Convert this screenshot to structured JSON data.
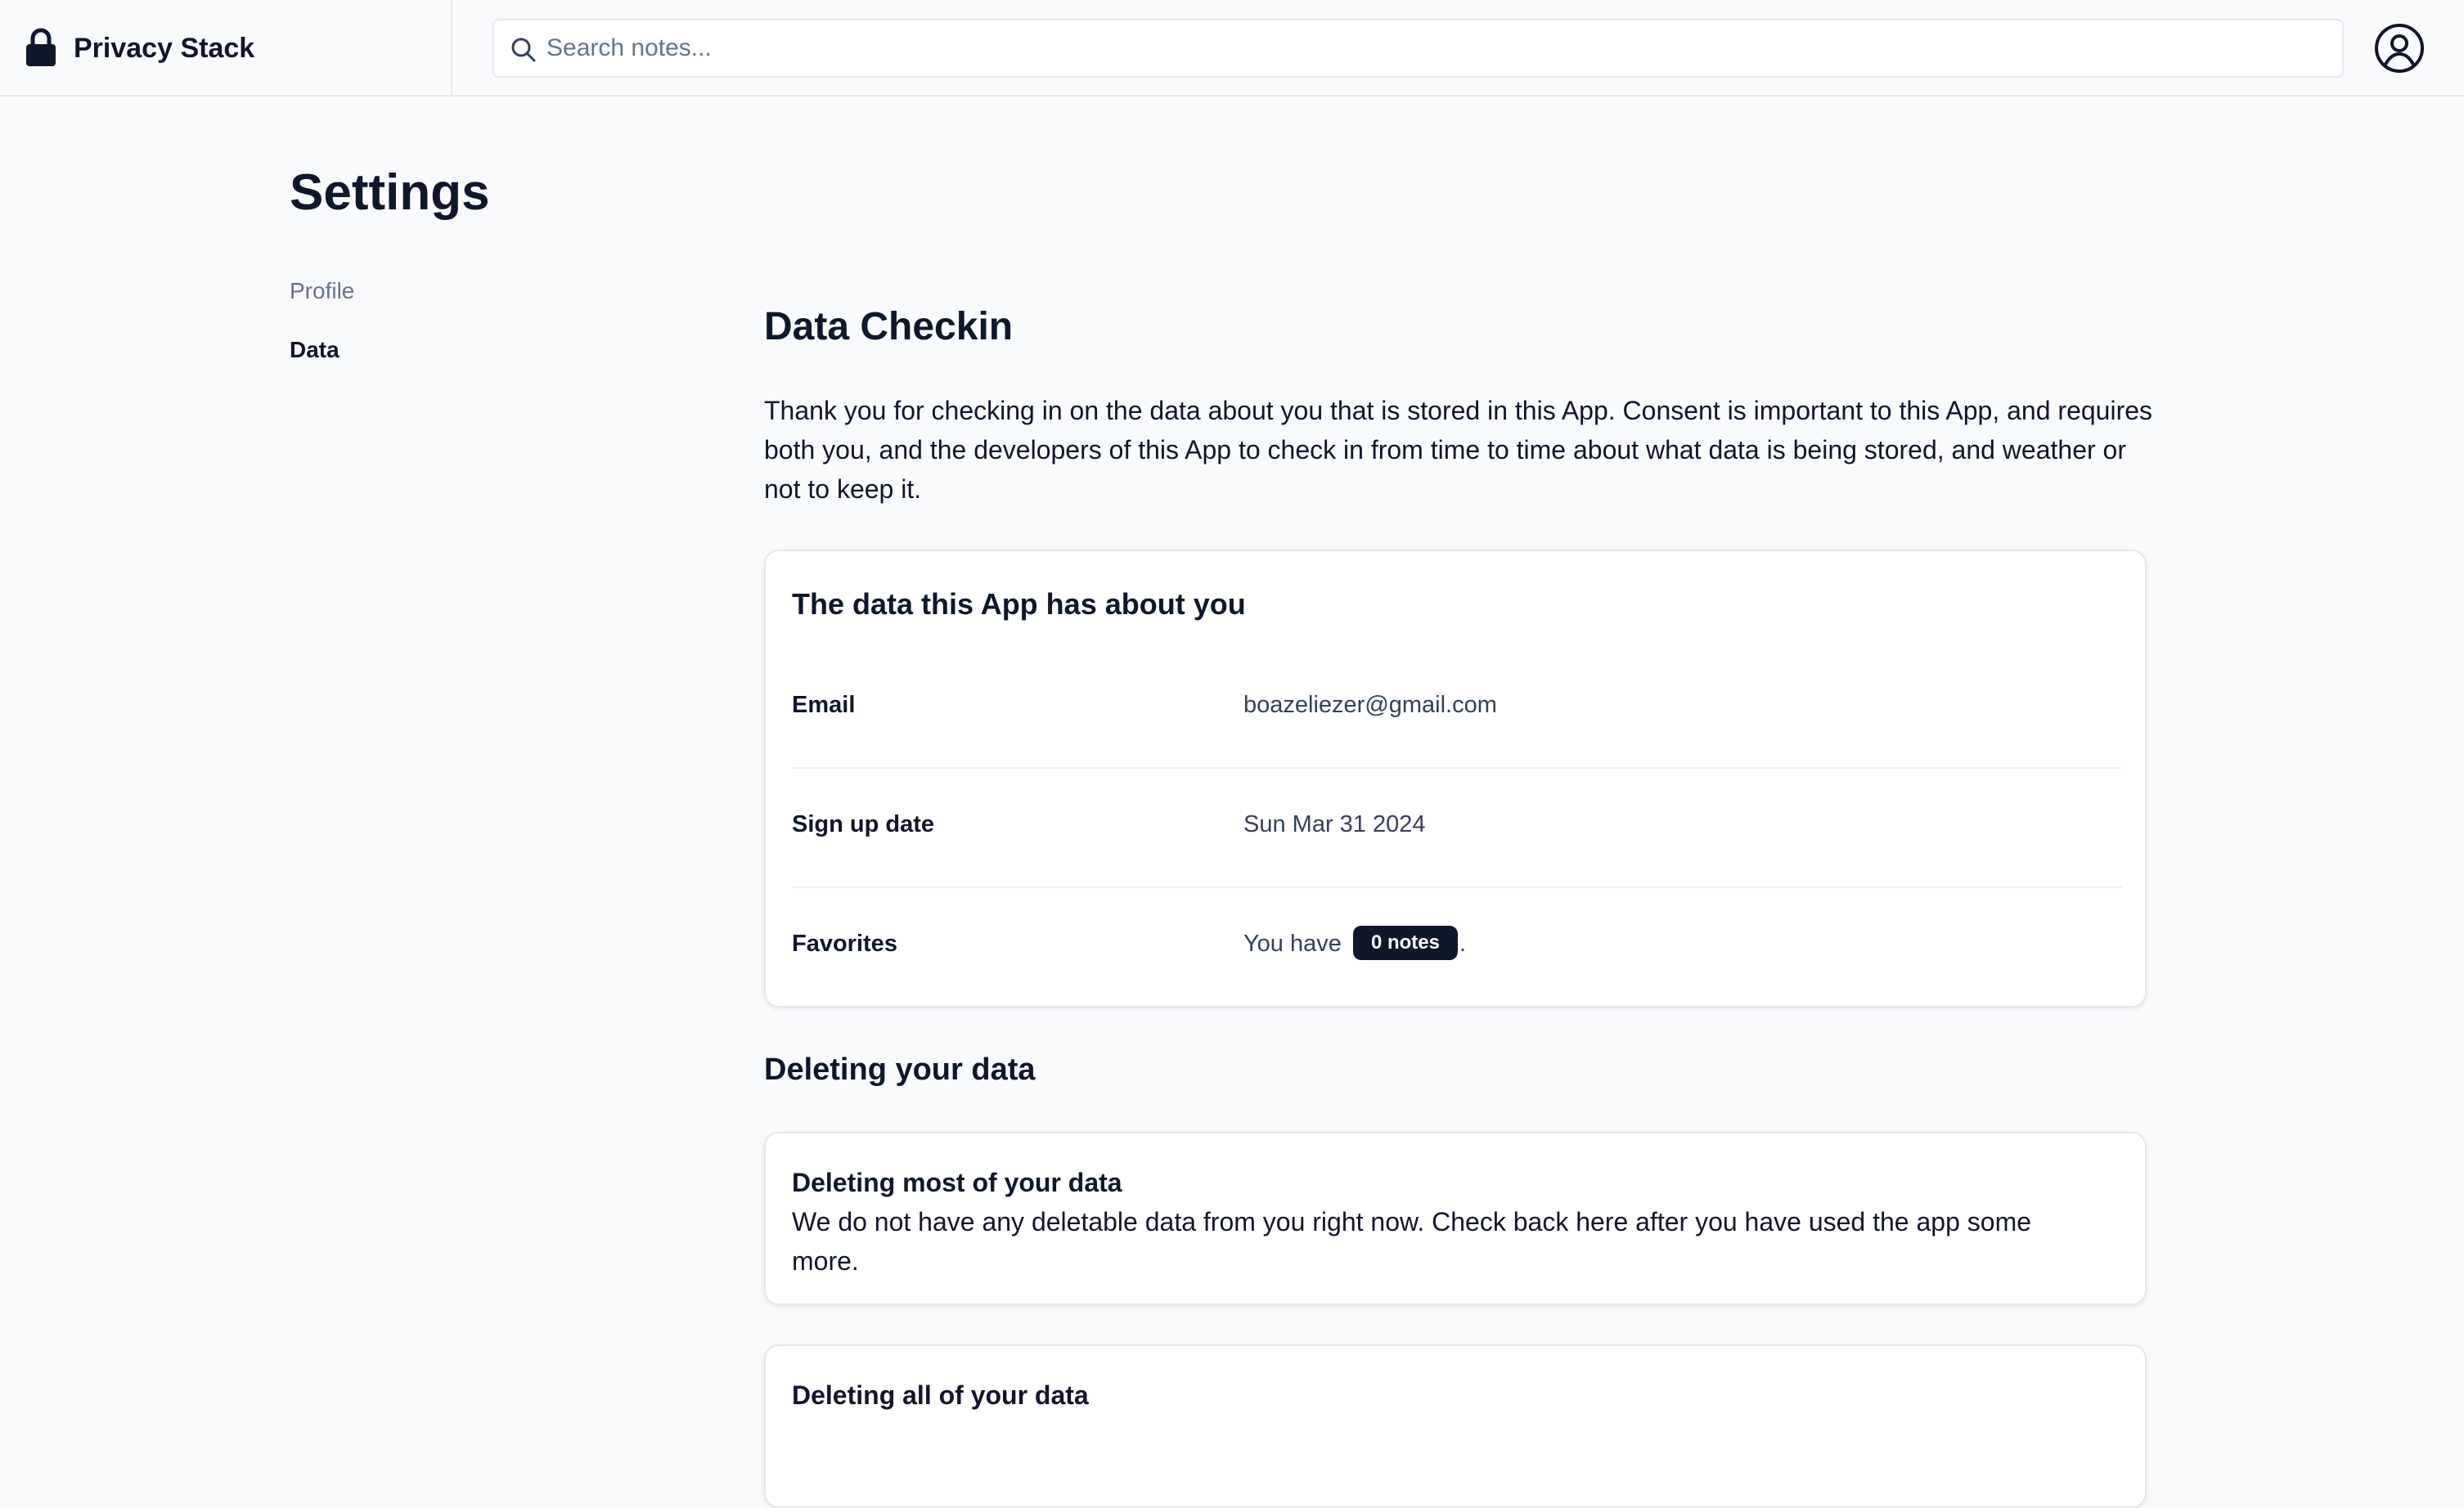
{
  "header": {
    "app_name": "Privacy Stack",
    "lock_icon": "lock-icon",
    "search": {
      "icon": "search-icon",
      "placeholder": "Search notes...",
      "value": ""
    },
    "avatar_icon": "user-circle-icon"
  },
  "page": {
    "title": "Settings"
  },
  "settings_nav": {
    "items": [
      {
        "label": "Profile",
        "active": false
      },
      {
        "label": "Data",
        "active": true
      }
    ]
  },
  "data_checkin": {
    "title": "Data Checkin",
    "intro": "Thank you for checking in on the data about you that is stored in this App. Consent is important to this App, and requires both you, and the developers of this App to check in from time to time about what data is being stored, and weather or not to keep it.",
    "card": {
      "title": "The data this App has about you",
      "rows": [
        {
          "label": "Email",
          "value": "boazeliezer@gmail.com"
        },
        {
          "label": "Sign up date",
          "value": "Sun Mar 31 2024"
        },
        {
          "label": "Favorites",
          "value_prefix": "You have",
          "badge": "0 notes",
          "value_suffix": "."
        }
      ]
    }
  },
  "deleting": {
    "title": "Deleting your data",
    "cards": [
      {
        "title": "Deleting most of your data",
        "text": "We do not have any deletable data from you right now. Check back here after you have used the app some more."
      },
      {
        "title": "Deleting all of your data",
        "text": ""
      }
    ]
  },
  "colors": {
    "background": "#f8fafc",
    "text": "#0f172a",
    "muted": "#64748b",
    "badge_bg": "#0f172a",
    "border": "#e5e7eb"
  }
}
